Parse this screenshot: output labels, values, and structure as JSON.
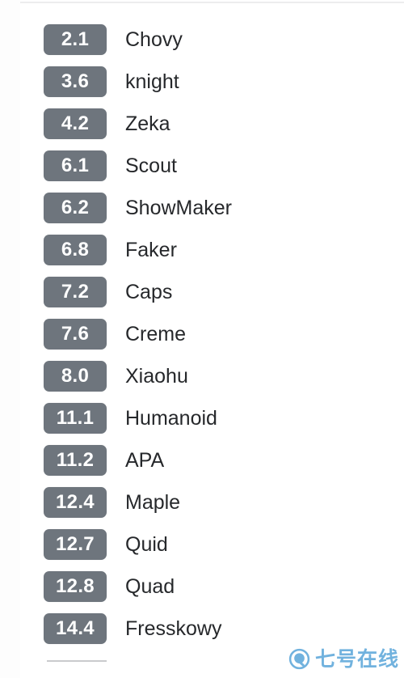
{
  "list": {
    "rows": [
      {
        "score": "2.1",
        "name": "Chovy"
      },
      {
        "score": "3.6",
        "name": "knight"
      },
      {
        "score": "4.2",
        "name": "Zeka"
      },
      {
        "score": "6.1",
        "name": "Scout"
      },
      {
        "score": "6.2",
        "name": "ShowMaker"
      },
      {
        "score": "6.8",
        "name": "Faker"
      },
      {
        "score": "7.2",
        "name": "Caps"
      },
      {
        "score": "7.6",
        "name": "Creme"
      },
      {
        "score": "8.0",
        "name": "Xiaohu"
      },
      {
        "score": "11.1",
        "name": "Humanoid"
      },
      {
        "score": "11.2",
        "name": "APA"
      },
      {
        "score": "12.4",
        "name": "Maple"
      },
      {
        "score": "12.7",
        "name": "Quid"
      },
      {
        "score": "12.8",
        "name": "Quad"
      },
      {
        "score": "14.4",
        "name": "Fresskowy"
      }
    ]
  },
  "watermark": {
    "text": "七号在线",
    "logo_letter": "Q",
    "color": "#6aaedd"
  },
  "colors": {
    "badge_background": "#6e757d",
    "badge_text": "#ffffff",
    "name_text": "#26282b",
    "sheet_background": "#ffffff",
    "rule": "#c9cbcd"
  }
}
